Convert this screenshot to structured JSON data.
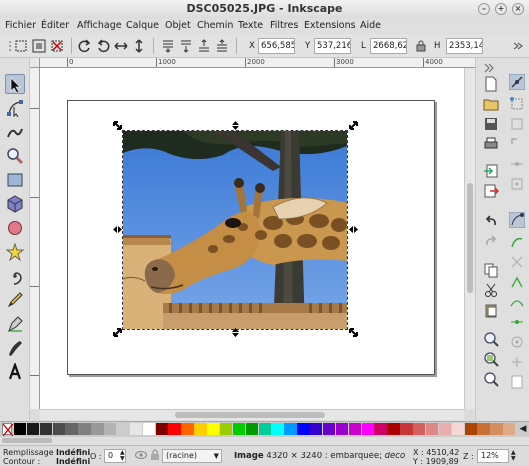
{
  "window": {
    "title": "DSC05025.JPG - Inkscape"
  },
  "menu": [
    "Fichier",
    "Éditer",
    "Affichage",
    "Calque",
    "Objet",
    "Chemin",
    "Texte",
    "Filtres",
    "Extensions",
    "Aide"
  ],
  "commandbar": {
    "x_label": "X",
    "x_value": "656,585",
    "y_label": "Y",
    "y_value": "537,216",
    "w_label": "L",
    "w_value": "2668,62",
    "h_label": "H",
    "h_value": "2353,14"
  },
  "ruler": {
    "labels": [
      "0",
      "1000",
      "2000",
      "3000",
      "4000"
    ]
  },
  "statusbar": {
    "fill_label": "Remplissage :",
    "fill_value": "Indéfini",
    "stroke_label": "Contour :",
    "stroke_value": "Indéfini",
    "opacity_label": "O :",
    "opacity_value": "0",
    "layer_value": "(racine)",
    "message_bold": "Image",
    "message_rest": " 4320 × 3240 : embarquée; ",
    "message_italic": "déco",
    "coord_x": "X : 4510,42",
    "coord_y": "Y : 1909,89",
    "zoom_label": "Z :",
    "zoom_value": "12%"
  },
  "colors": {
    "accent": "#7d8fa6",
    "selection_handles": "#000000",
    "palette": [
      "#000000",
      "#1a1a1a",
      "#333333",
      "#4d4d4d",
      "#666666",
      "#808080",
      "#999999",
      "#b3b3b3",
      "#cccccc",
      "#e6e6e6",
      "#ffffff",
      "#800000",
      "#ff0000",
      "#ff6600",
      "#ffcc00",
      "#ffff00",
      "#99cc00",
      "#00cc00",
      "#009900",
      "#00cc99",
      "#00ffff",
      "#0099ff",
      "#0000ff",
      "#3300cc",
      "#6600cc",
      "#9900cc",
      "#cc00cc",
      "#ff00ff",
      "#cc0066",
      "#aa0000",
      "#c83737",
      "#d35f5f",
      "#de8787",
      "#e9afaf",
      "#f4d7d7",
      "#aa4400",
      "#c87137",
      "#d38d5f",
      "#deaa87"
    ]
  },
  "icons": {
    "tools": [
      "selector-icon",
      "node-icon",
      "tweak-icon",
      "zoom-icon",
      "rectangle-icon",
      "box3d-icon",
      "ellipse-icon",
      "star-icon",
      "spiral-icon",
      "pencil-icon",
      "pen-icon",
      "calligraphy-icon",
      "text-icon"
    ]
  }
}
